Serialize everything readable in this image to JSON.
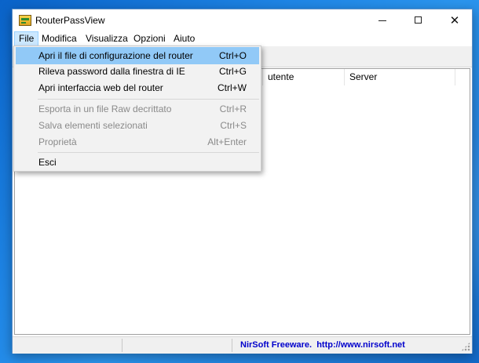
{
  "window": {
    "title": "RouterPassView",
    "icon": "router-key-icon",
    "controls": {
      "minimize": "minimize-icon",
      "maximize": "maximize-icon",
      "close_glyph": "✕"
    }
  },
  "menubar": {
    "items": [
      {
        "label": "File",
        "active": true
      },
      {
        "label": "Modifica"
      },
      {
        "label": "Visualizza"
      },
      {
        "label": "Opzioni"
      },
      {
        "label": "Aiuto"
      }
    ]
  },
  "file_menu": {
    "items": [
      {
        "label": "Apri il file di configurazione del router",
        "shortcut": "Ctrl+O",
        "highlighted": true,
        "enabled": true
      },
      {
        "label": "Rileva password dalla finestra di IE",
        "shortcut": "Ctrl+G",
        "enabled": true
      },
      {
        "label": "Apri interfaccia web del router",
        "shortcut": "Ctrl+W",
        "enabled": true
      },
      {
        "label": "Esporta in un file Raw decrittato",
        "shortcut": "Ctrl+R",
        "enabled": false
      },
      {
        "label": "Salva elementi selezionati",
        "shortcut": "Ctrl+S",
        "enabled": false
      },
      {
        "label": "Proprietà",
        "shortcut": "Alt+Enter",
        "enabled": false
      },
      {
        "label": "Esci",
        "shortcut": "",
        "enabled": true
      }
    ]
  },
  "list": {
    "columns": [
      "utente",
      "Server"
    ]
  },
  "statusbar": {
    "link_text": "NirSoft Freeware.  http://www.nirsoft.net"
  },
  "colors": {
    "menu_highlight": "#91c9f7",
    "menubar_active": "#cce8ff",
    "link": "#0000cc",
    "desktop": "#1f86e6"
  }
}
